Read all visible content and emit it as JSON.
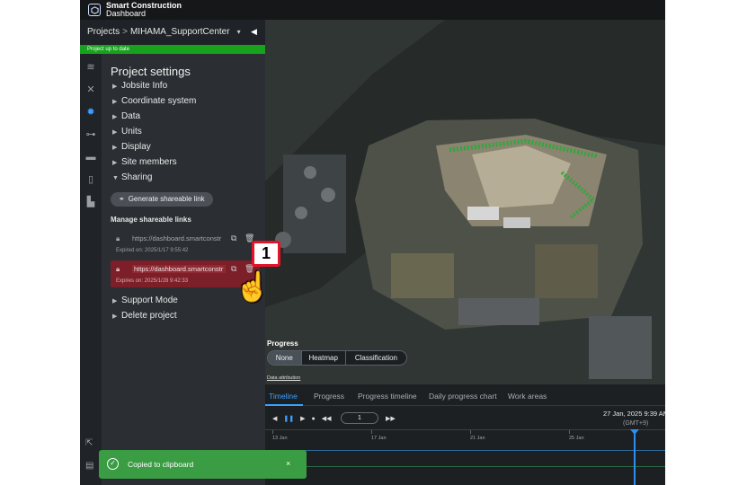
{
  "app": {
    "brand_line1": "Smart Construction",
    "brand_line2": "Dashboard"
  },
  "breadcrumb": {
    "root": "Projects",
    "separator": ">",
    "project": "MIHAMA_SupportCenter"
  },
  "status_text": "Project up to date",
  "rail_icons": [
    "layers-icon",
    "tools-icon",
    "gear-icon",
    "drone-icon",
    "folder-icon",
    "mobile-icon",
    "map-pin-icon"
  ],
  "settings": {
    "title": "Project settings",
    "items": [
      "Jobsite Info",
      "Coordinate system",
      "Data",
      "Units",
      "Display",
      "Site members"
    ],
    "sharing_label": "Sharing",
    "generate_button": "Generate shareable link",
    "manage_title": "Manage shareable links",
    "links": [
      {
        "url": "https://dashboard.smartconstr",
        "expires": "Expired on: 2025/1/17 9:55:42"
      },
      {
        "url": "https://dashboard.smartconstr",
        "expires": "Expires on: 2025/1/28 9:42:33"
      }
    ],
    "after_items": [
      "Support Mode",
      "Delete project"
    ]
  },
  "callout": {
    "number": "1"
  },
  "progress": {
    "title": "Progress",
    "options": [
      "None",
      "Heatmap",
      "Classification"
    ],
    "selected": "None"
  },
  "data_attribution": "Data attribution",
  "timeline": {
    "tabs": [
      "Timeline",
      "Progress",
      "Progress timeline",
      "Daily progress chart",
      "Work areas"
    ],
    "active_tab": "Timeline",
    "frame_value": "1",
    "datetime": "27 Jan, 2025 9:39 AM",
    "timezone": "(GMT+9)",
    "dates": [
      "13 Jan",
      "17 Jan",
      "21 Jan",
      "25 Jan"
    ]
  },
  "toast": {
    "message": "Copied to clipboard",
    "close": "×"
  },
  "colors": {
    "accent": "#3aa0ff",
    "status_green": "#17a11c",
    "highlight_red": "#7d1f28",
    "toast_green": "#3a9c43"
  }
}
